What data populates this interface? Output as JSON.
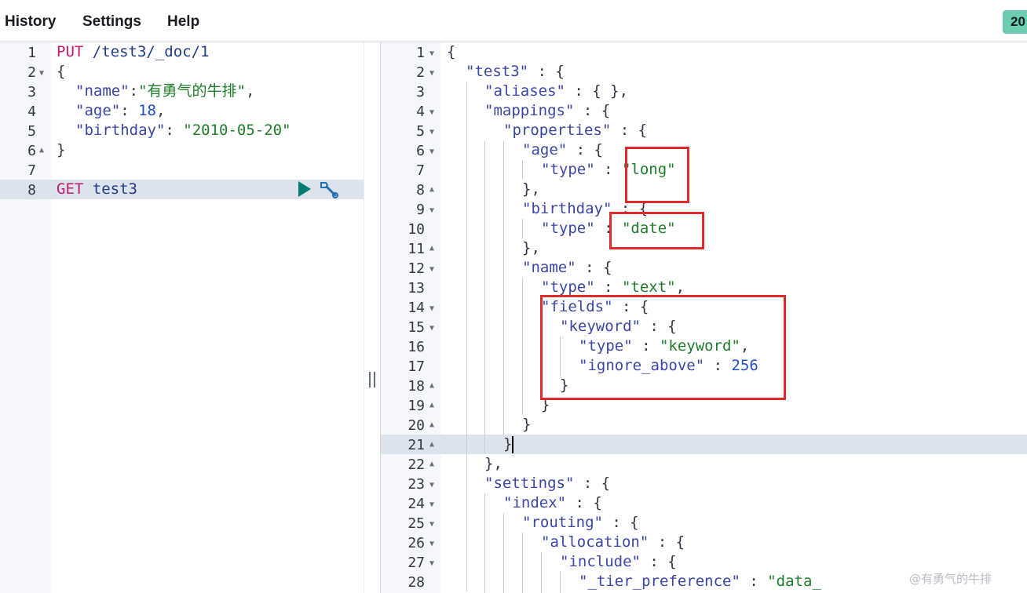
{
  "menu": {
    "history": "History",
    "settings": "Settings",
    "help": "Help"
  },
  "status_badge": "20",
  "left_editor": {
    "line_numbers": [
      "1",
      "2",
      "3",
      "4",
      "5",
      "6",
      "7",
      "8"
    ],
    "lines": {
      "l1_method": "PUT",
      "l1_url": "/test3/_doc/1",
      "l2": "{",
      "l3_key": "\"name\"",
      "l3_sep": ":",
      "l3_val": "\"有勇气的牛排\"",
      "l3_end": ",",
      "l4_key": "\"age\"",
      "l4_sep": ": ",
      "l4_val": "18",
      "l4_end": ",",
      "l5_key": "\"birthday\"",
      "l5_sep": ": ",
      "l5_val": "\"2010-05-20\"",
      "l6": "}",
      "l8_method": "GET",
      "l8_url": "test3"
    },
    "icons": {
      "run": "play-icon",
      "settings": "wrench-icon"
    }
  },
  "right_editor": {
    "line_numbers": [
      "1",
      "2",
      "3",
      "4",
      "5",
      "6",
      "7",
      "8",
      "9",
      "10",
      "11",
      "12",
      "13",
      "14",
      "15",
      "16",
      "17",
      "18",
      "19",
      "20",
      "21",
      "22",
      "23",
      "24",
      "25",
      "26",
      "27",
      "28"
    ],
    "lines": {
      "r1": "{",
      "r2_key": "\"test3\"",
      "r2_rest": " : {",
      "r3_key": "\"aliases\"",
      "r3_rest": " : { },",
      "r4_key": "\"mappings\"",
      "r4_rest": " : {",
      "r5_key": "\"properties\"",
      "r5_rest": " : {",
      "r6_key": "\"age\"",
      "r6_rest": " : {",
      "r7_key": "\"type\"",
      "r7_sep": " : ",
      "r7_val": "\"long\"",
      "r8": "},",
      "r9_key": "\"birthday\"",
      "r9_rest": " : {",
      "r10_key": "\"type\"",
      "r10_sep": " : ",
      "r10_val": "\"date\"",
      "r11": "},",
      "r12_key": "\"name\"",
      "r12_rest": " : {",
      "r13_key": "\"type\"",
      "r13_sep": " : ",
      "r13_val": "\"text\"",
      "r13_end": ",",
      "r14_key": "\"fields\"",
      "r14_rest": " : {",
      "r15_key": "\"keyword\"",
      "r15_rest": " : {",
      "r16_key": "\"type\"",
      "r16_sep": " : ",
      "r16_val": "\"keyword\"",
      "r16_end": ",",
      "r17_key": "\"ignore_above\"",
      "r17_sep": " : ",
      "r17_val": "256",
      "r18": "}",
      "r19": "}",
      "r20": "}",
      "r21": "}",
      "r22": "},",
      "r23_key": "\"settings\"",
      "r23_rest": " : {",
      "r24_key": "\"index\"",
      "r24_rest": " : {",
      "r25_key": "\"routing\"",
      "r25_rest": " : {",
      "r26_key": "\"allocation\"",
      "r26_rest": " : {",
      "r27_key": "\"include\"",
      "r27_rest": " : {",
      "r28_key": "\"_tier_preference\"",
      "r28_sep": " : ",
      "r28_val": "\"data_"
    }
  },
  "watermark": "@有勇气的牛排",
  "colors": {
    "keys": "#3a46a8",
    "strings": "#1e7e2a",
    "method": "#c41a6a",
    "highlight": "#e02b2b",
    "badge": "#6dccb1"
  }
}
